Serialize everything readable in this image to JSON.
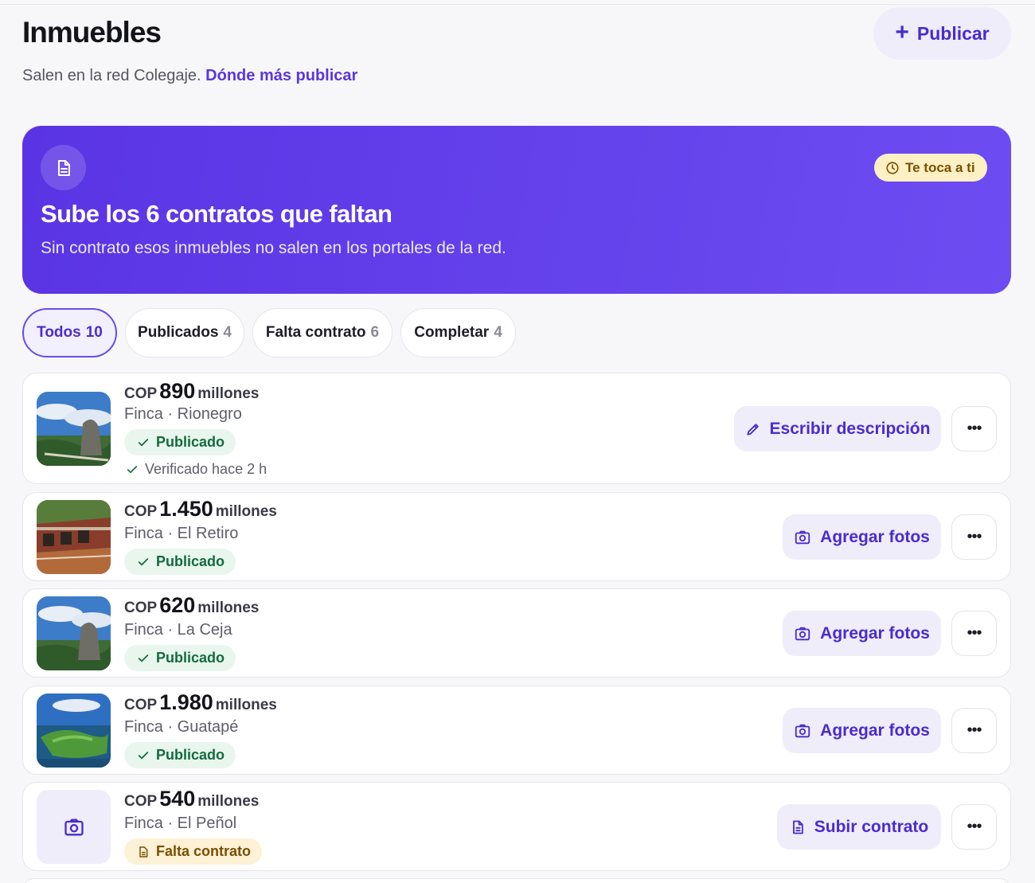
{
  "header": {
    "title": "Inmuebles",
    "subtitle_text": "Salen en la red Colegaje.",
    "subtitle_link": "Dónde más publicar",
    "publish_label": "Publicar",
    "publish_icon": "plus-icon"
  },
  "banner": {
    "icon": "document-icon",
    "title": "Sube los 6 contratos que faltan",
    "text": "Sin contrato esos inmuebles no salen en los portales de la red.",
    "badge_icon": "clock-icon",
    "badge": "Te toca a ti",
    "background": "#5a34e4"
  },
  "tabs": [
    {
      "label": "Todos",
      "count": "10",
      "active": true
    },
    {
      "label": "Publicados",
      "count": "4"
    },
    {
      "label": "Falta contrato",
      "count": "6"
    },
    {
      "label": "Completar",
      "count": "4"
    }
  ],
  "listings": [
    {
      "currency": "COP",
      "amount": "890",
      "unit": "millones",
      "type_location": "Finca · Rionegro",
      "status": "Publicado",
      "verified": "Verificado hace 2 h",
      "action": "Escribir descripción",
      "action_icon": "pencil-icon",
      "more": "•••"
    },
    {
      "currency": "COP",
      "amount": "1.450",
      "unit": "millones",
      "type_location": "Finca · El Retiro",
      "status": "Publicado",
      "action": "Agregar fotos",
      "action_icon": "camera-icon",
      "more": "•••"
    },
    {
      "currency": "COP",
      "amount": "620",
      "unit": "millones",
      "type_location": "Finca · La Ceja",
      "status": "Publicado",
      "action": "Agregar fotos",
      "action_icon": "camera-icon",
      "more": "•••"
    },
    {
      "currency": "COP",
      "amount": "1.980",
      "unit": "millones",
      "type_location": "Finca · Guatapé",
      "status": "Publicado",
      "action": "Agregar fotos",
      "action_icon": "camera-icon",
      "more": "•••"
    },
    {
      "currency": "COP",
      "amount": "540",
      "unit": "millones",
      "type_location": "Finca · El Peñol",
      "status": "Falta contrato",
      "action": "Subir contrato",
      "action_icon": "document-icon",
      "more": "•••"
    }
  ],
  "colors": {
    "accent": "#5b35e0",
    "published_bg": "#e8f6ee",
    "published_text": "#136b3c",
    "warning_bg": "#fdf1d6",
    "warning_text": "#7a4e00"
  }
}
